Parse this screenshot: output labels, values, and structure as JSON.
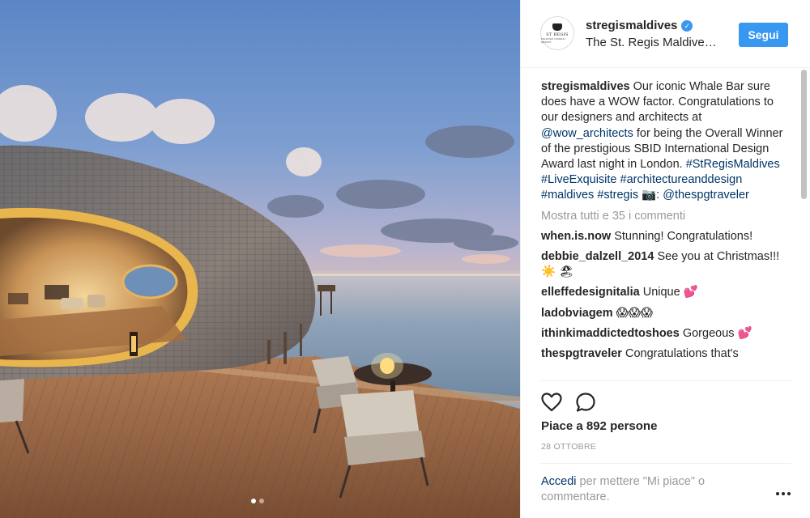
{
  "post": {
    "username": "stregismaldives",
    "subtitle": "The St. Regis Maldive…",
    "follow_label": "Segui",
    "avatar_logo_text": "ST REGIS",
    "avatar_logo_sub": "MALDIVES VOMMULI RESORT"
  },
  "caption": {
    "user": "stregismaldives",
    "text_1": " Our iconic Whale Bar sure does have a WOW factor. Congratulations to our designers and architects at ",
    "mention_1": "@wow_architects",
    "text_2": " for being the Overall Winner of the prestigious SBID International Design Award last night in London. ",
    "hashtag_1": "#StRegisMaldives",
    "hashtag_2": "#LiveExquisite",
    "hashtag_3": "#architectureanddesign",
    "hashtag_4": "#maldives",
    "hashtag_5": "#stregis",
    "camera_emoji": "📷",
    "text_3": ": ",
    "mention_2": "@thespgtraveler"
  },
  "view_all_comments": "Mostra tutti e 35 i commenti",
  "comments": [
    {
      "user": "when.is.now",
      "text": "Stunning! Congratulations!"
    },
    {
      "user": "debbie_dalzell_2014",
      "text": "See you at Christmas!!! ☀️ 🏖"
    },
    {
      "user": "elleffedesignitalia",
      "text": "Unique 💕"
    },
    {
      "user": "ladobviagem",
      "text": "😱😱😱"
    },
    {
      "user": "ithinkimaddictedtoshoes",
      "text": "Gorgeous 💕"
    },
    {
      "user": "thespgtraveler",
      "text": "Congratulations that's"
    }
  ],
  "likes_text": "Piace a 892 persone",
  "date_text": "28 OTTOBRE",
  "login": {
    "link": "Accedi",
    "text": " per mettere \"Mi piace\" o commentare."
  },
  "icons": {
    "like": "heart-outline-icon",
    "comment": "comment-bubble-icon",
    "more": "more-options-icon",
    "verified": "verified-badge-icon"
  },
  "colors": {
    "accent": "#3897f0",
    "link": "#003569",
    "muted": "#999999"
  },
  "carousel": {
    "current": 1,
    "total": 2
  }
}
